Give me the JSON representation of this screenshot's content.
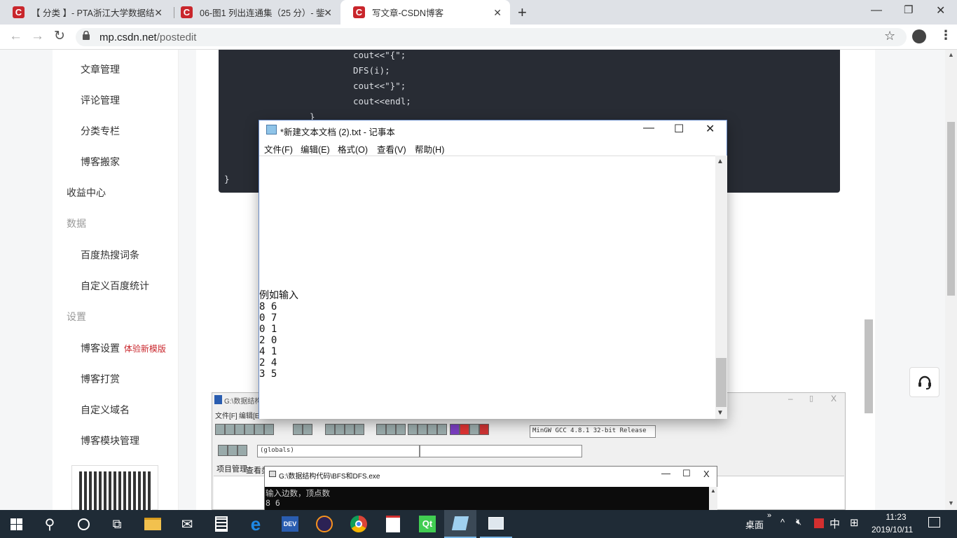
{
  "browser": {
    "tabs": [
      {
        "label": "【 分类 】- PTA浙江大学数据结",
        "icon": "C"
      },
      {
        "label": "06-图1 列出连通集（25 分）- 鈭",
        "icon": "C"
      },
      {
        "label": "写文章-CSDN博客",
        "icon": "C"
      }
    ],
    "url_host": "mp.csdn.net",
    "url_path": "/postedit",
    "new_tab": "+"
  },
  "sidebar": {
    "items": [
      {
        "label": "文章管理"
      },
      {
        "label": "评论管理"
      },
      {
        "label": "分类专栏"
      },
      {
        "label": "博客搬家"
      },
      {
        "label": "收益中心"
      },
      {
        "label": "数据"
      },
      {
        "label": "百度热搜词条"
      },
      {
        "label": "自定义百度统计"
      },
      {
        "label": "设置"
      },
      {
        "label": "博客设置"
      },
      {
        "label": "博客打赏"
      },
      {
        "label": "自定义域名"
      },
      {
        "label": "博客模块管理"
      }
    ],
    "new_template_badge": "体验新模版"
  },
  "code": {
    "lines": [
      "cout<<\"{\";",
      "DFS(i);",
      "cout<<\"}\";",
      "cout<<endl;",
      "}",
      "}"
    ]
  },
  "notepad": {
    "title": "*新建文本文档 (2).txt - 记事本",
    "menu": [
      "文件(F)",
      "编辑(E)",
      "格式(O)",
      "查看(V)",
      "帮助(H)"
    ],
    "content": "例如输入\n8 6\n0 7\n0 1\n2 0\n4 1\n2 4\n3 5"
  },
  "devcpp": {
    "title": "G:\\数据结构代",
    "menu": [
      "文件[F]",
      "编辑[E"
    ],
    "compiler": "MinGW GCC 4.8.1 32-bit Release",
    "scope": "(globals)",
    "tabs": [
      "项目管理",
      "查看类"
    ]
  },
  "console": {
    "title": "G:\\数据结构代码\\BFS和DFS.exe",
    "content": "输入边数，顶点数\n8 6"
  },
  "taskbar": {
    "desktop_label": "桌面",
    "ime": "中",
    "time": "11:23",
    "date": "2019/10/11",
    "apps": [
      "file-explorer",
      "mail",
      "calculator",
      "edge",
      "dev-cpp",
      "eclipse",
      "chrome",
      "acrobat",
      "qt-creator",
      "notepad",
      "app"
    ]
  }
}
